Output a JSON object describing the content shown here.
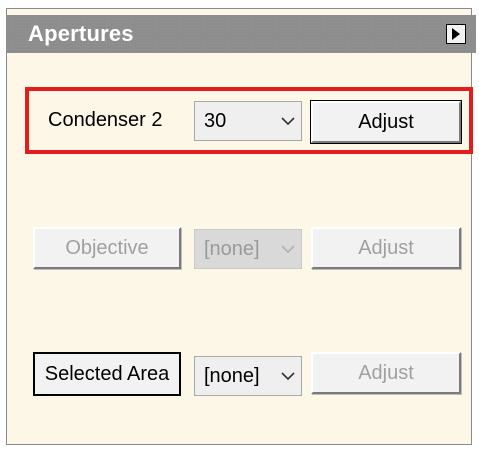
{
  "panel": {
    "title": "Apertures"
  },
  "rows": [
    {
      "name": "Condenser 2",
      "value": "30",
      "action": "Adjust"
    },
    {
      "name": "Objective",
      "value": "[none]",
      "action": "Adjust"
    },
    {
      "name": "Selected Area",
      "value": "[none]",
      "action": "Adjust"
    }
  ],
  "colors": {
    "highlight": "#e41c1c",
    "panel_bg": "#fdf7e8",
    "titlebar": "#8d8d8d"
  },
  "icons": {
    "title_button": "triangle-right-icon",
    "dropdown": "chevron-down-icon"
  }
}
